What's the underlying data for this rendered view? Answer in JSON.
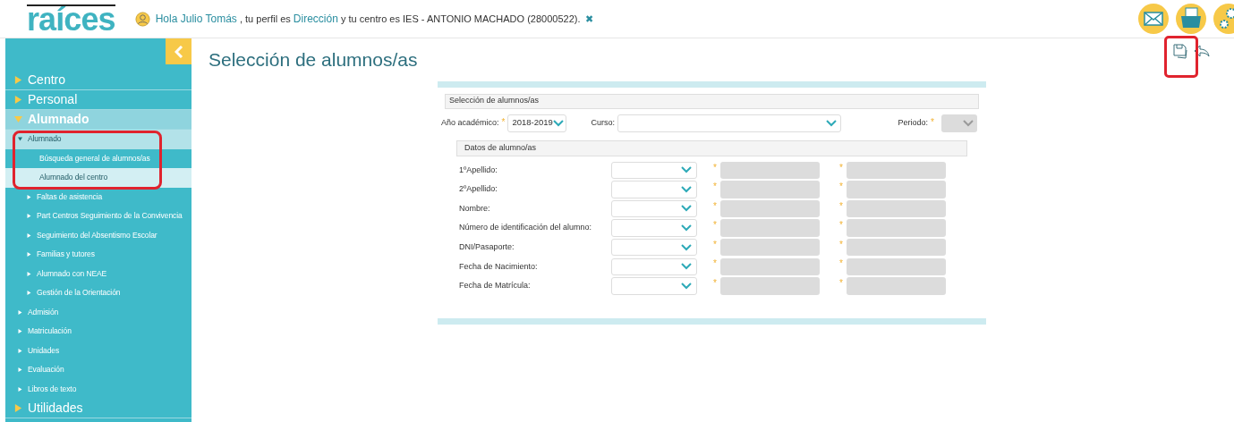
{
  "header": {
    "logo": "raíces",
    "greeting": [
      {
        "kind": "link",
        "text": "Hola Julio Tomás"
      },
      {
        "kind": "text",
        "text": " , tu perfil es "
      },
      {
        "kind": "link",
        "text": "Dirección"
      },
      {
        "kind": "text",
        "text": " y tu centro es IES - ANTONIO MACHADO (28000522)."
      }
    ],
    "close": "✖"
  },
  "sidebar": {
    "items": [
      {
        "label": "Centro",
        "expanded": false
      },
      {
        "label": "Personal",
        "expanded": false
      },
      {
        "label": "Alumnado",
        "expanded": true,
        "children": [
          {
            "label": "Alumnado",
            "expanded": true,
            "children": [
              {
                "label": "Búsqueda general de alumnos/as",
                "selected": false
              },
              {
                "label": "Alumnado del centro",
                "selected": true
              },
              {
                "label": "Faltas de asistencia",
                "expanded": false
              },
              {
                "label": "Part Centros Seguimiento de la Convivencia",
                "expanded": false
              },
              {
                "label": "Seguimiento del Absentismo Escolar",
                "expanded": false
              },
              {
                "label": "Familias y tutores",
                "expanded": false
              },
              {
                "label": "Alumnado con NEAE",
                "expanded": false
              },
              {
                "label": "Gestión de la Orientación",
                "expanded": false
              }
            ]
          },
          {
            "label": "Admisión",
            "expanded": false
          },
          {
            "label": "Matriculación",
            "expanded": false
          },
          {
            "label": "Unidades",
            "expanded": false
          },
          {
            "label": "Evaluación",
            "expanded": false
          },
          {
            "label": "Libros de texto",
            "expanded": false
          }
        ]
      },
      {
        "label": "Utilidades",
        "expanded": false
      }
    ]
  },
  "page": {
    "title": "Selección de alumnos/as"
  },
  "form": {
    "section": "Selección de alumnos/as",
    "academic_year": {
      "label": "Año académico:",
      "required_mark": "*",
      "value": "2018-2019"
    },
    "course": {
      "label": "Curso:"
    },
    "period": {
      "label": "Periodo:",
      "required_mark": "*",
      "disabled": true
    },
    "student_section": "Datos de alumno/as",
    "rows": [
      {
        "label": "1ºApellido:",
        "marks": [
          "*",
          "*"
        ]
      },
      {
        "label": "2ºApellido:",
        "marks": [
          "*",
          "*"
        ]
      },
      {
        "label": "Nombre:",
        "marks": [
          "*",
          "*"
        ]
      },
      {
        "label": "Número de identificación del alumno:",
        "marks": [
          "*",
          "*"
        ]
      },
      {
        "label": "DNI/Pasaporte:",
        "marks": [
          "*",
          "*"
        ]
      },
      {
        "label": "Fecha de Nacimiento:",
        "marks": [
          "*",
          "*"
        ]
      },
      {
        "label": "Fecha de Matrícula:",
        "marks": [
          "*",
          "*"
        ]
      }
    ]
  }
}
